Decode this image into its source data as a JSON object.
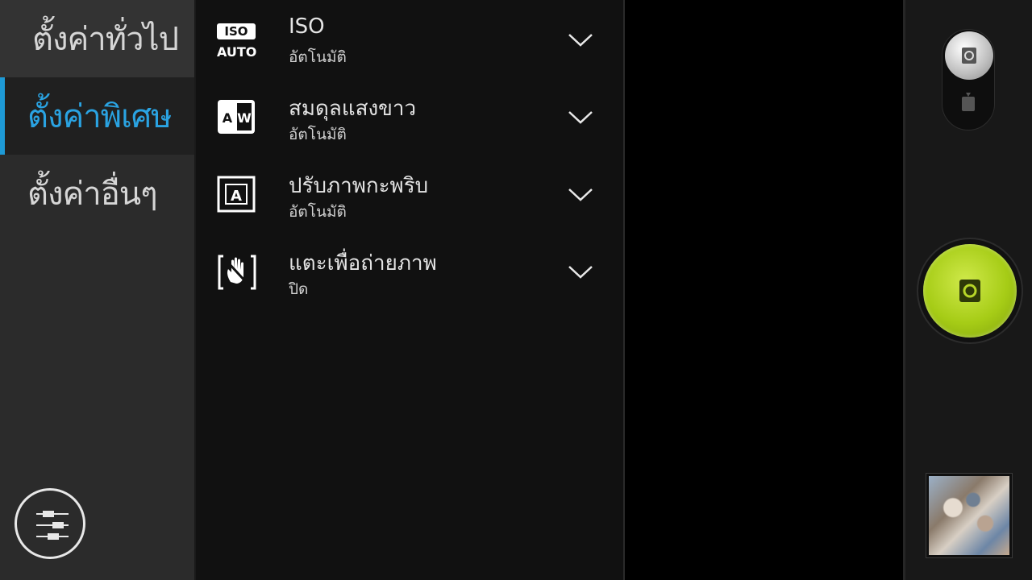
{
  "sidebar": {
    "items": [
      {
        "label": "ตั้งค่าทั่วไป"
      },
      {
        "label": "ตั้งค่าพิเศษ",
        "selected": true
      },
      {
        "label": "ตั้งค่าอื่นๆ"
      }
    ],
    "accent_color": "#1e9ad6"
  },
  "settings": {
    "rows": [
      {
        "title": "ISO",
        "value": "อัตโนมัติ",
        "icon": "iso-auto-icon",
        "icon_top": "ISO",
        "icon_bottom": "AUTO"
      },
      {
        "title": "สมดุลแสงขาว",
        "value": "อัตโนมัติ",
        "icon": "white-balance-auto-icon",
        "icon_text": "AW"
      },
      {
        "title": "ปรับภาพกะพริบ",
        "value": "อัตโนมัติ",
        "icon": "anti-flicker-auto-icon",
        "icon_text": "A"
      },
      {
        "title": "แตะเพื่อถ่ายภาพ",
        "value": "ปิด",
        "icon": "touch-capture-icon"
      }
    ]
  },
  "controls": {
    "shutter_color": "#a6cc16",
    "mode": "photo"
  }
}
